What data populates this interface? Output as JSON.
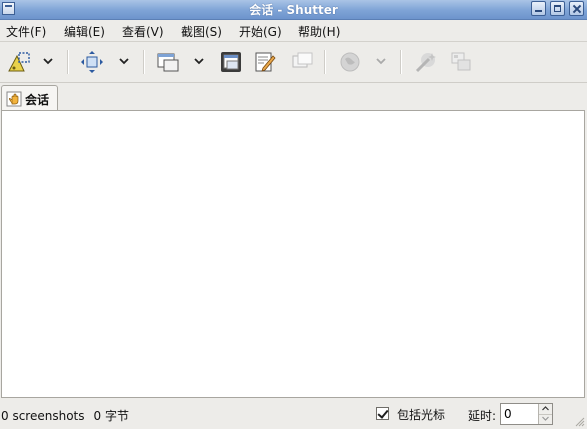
{
  "window": {
    "title": "会话 - Shutter"
  },
  "menubar": {
    "items": [
      {
        "label": "文件(F)"
      },
      {
        "label": "编辑(E)"
      },
      {
        "label": "查看(V)"
      },
      {
        "label": "截图(S)"
      },
      {
        "label": "开始(G)"
      },
      {
        "label": "帮助(H)"
      }
    ]
  },
  "toolbar": {
    "icons": [
      "selection-icon",
      "dropdown-arrow-icon",
      "fullscreen-icon",
      "dropdown-arrow-icon",
      "window-icon",
      "dropdown-arrow-icon",
      "active-window-icon",
      "edit-icon",
      "tooltip-icon",
      "web-icon",
      "dropdown-arrow-icon",
      "magic-wand-icon",
      "redo-icon"
    ]
  },
  "tabs": [
    {
      "label": "会话",
      "icon": "session-hand-icon"
    }
  ],
  "statusbar": {
    "count": "0 screenshots",
    "size": "0 字节",
    "cursor_label": "包括光标",
    "cursor_checked": true,
    "delay_label": "延时:",
    "delay_value": "0"
  },
  "colors": {
    "titlebar": "#7ea3d6",
    "content": "#ffffff",
    "chrome": "#edece9"
  }
}
